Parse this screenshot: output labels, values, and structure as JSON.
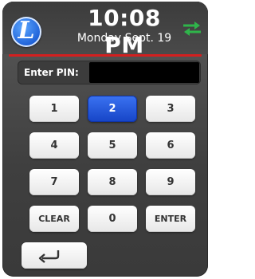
{
  "header": {
    "logo_letter": "L",
    "time": "10:08 PM",
    "date": "Monday Sept. 19",
    "status_icon": "sync-arrows-icon",
    "accent_color": "#2fb44a"
  },
  "divider_color": "#d31f1f",
  "pin": {
    "label": "Enter PIN:",
    "value": ""
  },
  "keypad": {
    "keys": [
      "1",
      "2",
      "3",
      "4",
      "5",
      "6",
      "7",
      "8",
      "9",
      "CLEAR",
      "0",
      "ENTER"
    ],
    "highlighted_key": "2",
    "highlight_color": "#1f55d8",
    "back_icon": "return-arrow-icon"
  }
}
